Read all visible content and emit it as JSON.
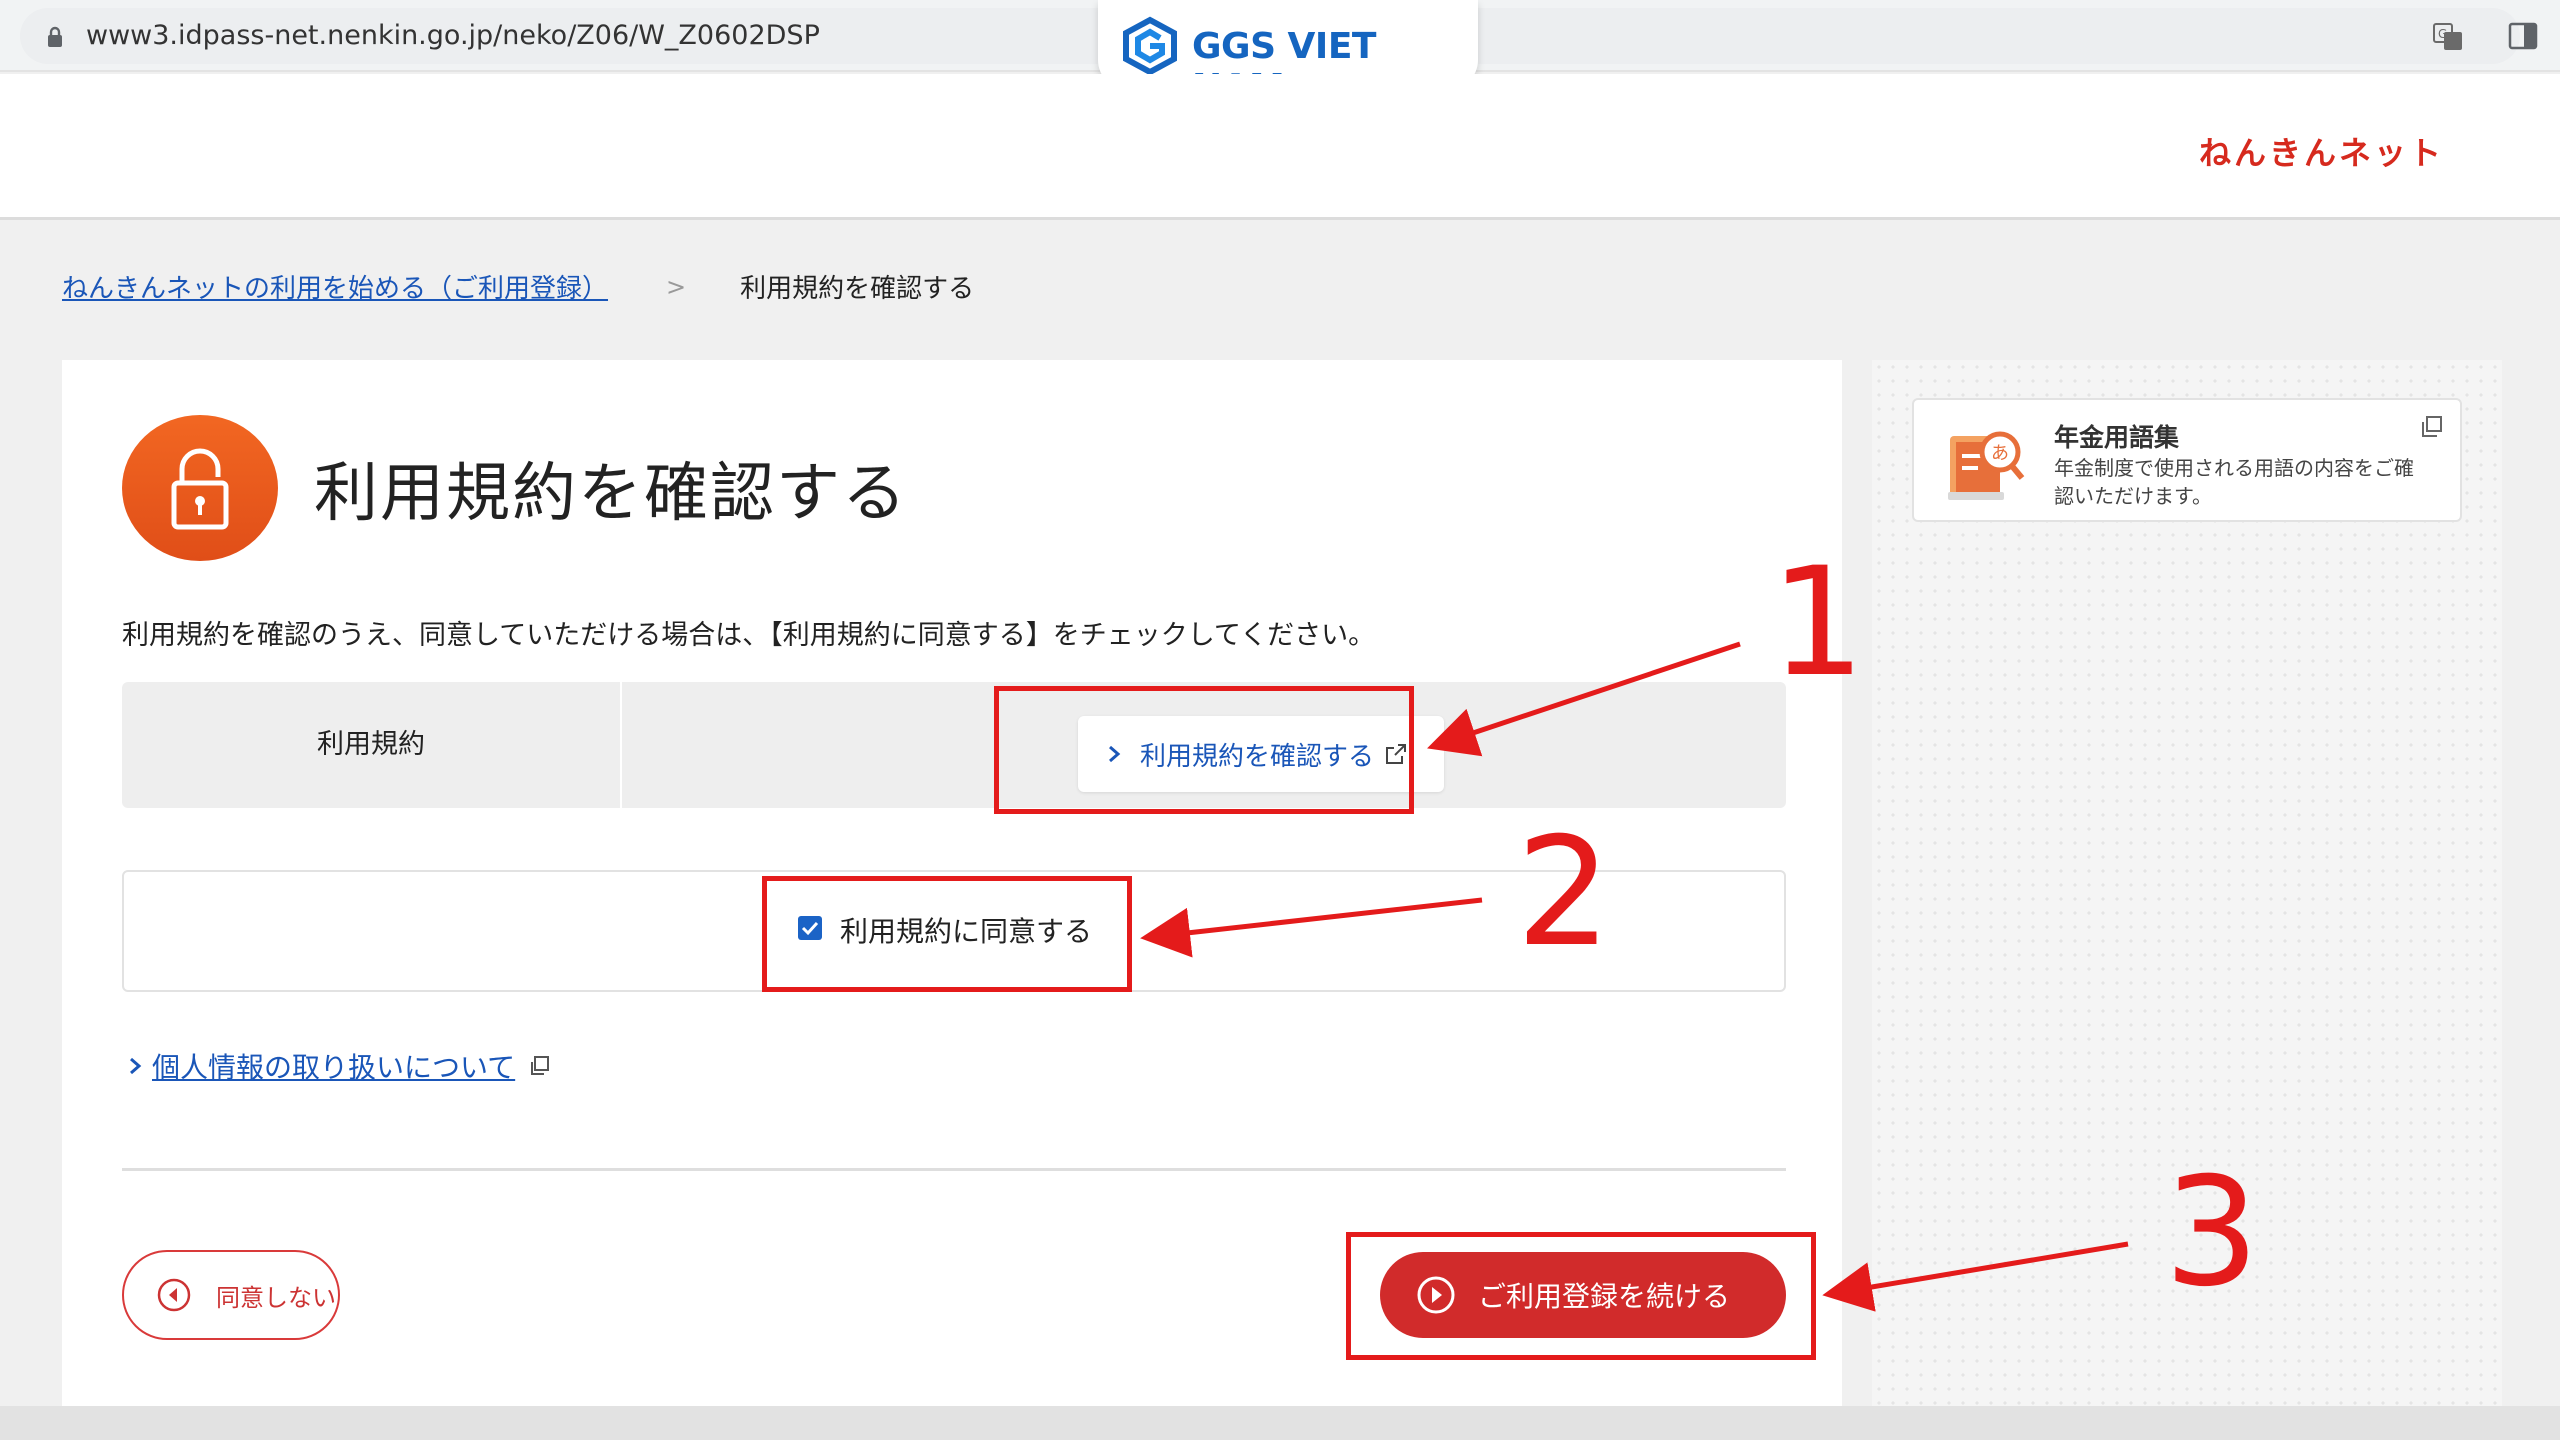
{
  "browser": {
    "url": "www3.idpass-net.nenkin.go.jp/neko/Z06/W_Z0602DSP"
  },
  "watermark": {
    "logo_text": "GGS VIET NAM"
  },
  "header": {
    "brand": "ねんきんネット"
  },
  "breadcrumb": {
    "parent": "ねんきんネットの利用を始める（ご利用登録）",
    "separator": ">",
    "current": "利用規約を確認する"
  },
  "main": {
    "title": "利用規約を確認する",
    "instruction": "利用規約を確認のうえ、同意していただける場合は、【利用規約に同意する】をチェックしてください。",
    "terms_label": "利用規約",
    "terms_button": "利用規約を確認する",
    "agree_label": "利用規約に同意する",
    "agree_checked": true,
    "privacy_link": "個人情報の取り扱いについて",
    "disagree_button": "同意しない",
    "continue_button": "ご利用登録を続ける"
  },
  "sidebar": {
    "glossary_title": "年金用語集",
    "glossary_desc": "年金制度で使用される用語の内容をご確認いただけます。"
  },
  "annotations": {
    "labels": [
      "1",
      "2",
      "3"
    ],
    "color": "#e41b1b"
  },
  "colors": {
    "accent_red": "#d12b2b",
    "link_blue": "#1a56b8",
    "icon_orange": "#f26722"
  }
}
